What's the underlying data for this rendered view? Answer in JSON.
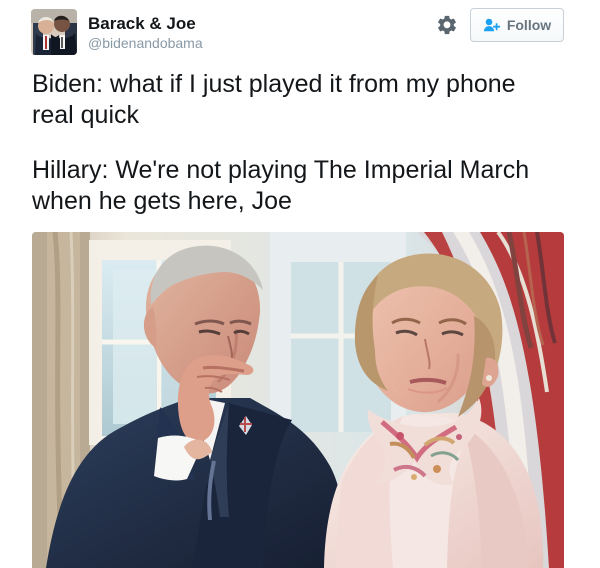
{
  "user": {
    "display_name": "Barack & Joe",
    "handle": "@bidenandobama",
    "avatar_icon": "profile-photo"
  },
  "actions": {
    "settings_icon": "gear-icon",
    "follow_icon": "follow-person-plus-icon",
    "follow_label": "Follow"
  },
  "tweet": {
    "line_1": "Biden: what if I just played it from my phone\nreal quick",
    "line_2": "Hillary: We're not playing The Imperial March\nwhen he gets here, Joe"
  },
  "media": {
    "type": "photo",
    "colors": {
      "flag_red": "#b83a3a",
      "window_blue": "#b8d2db",
      "suit_navy": "#162542",
      "jacket_pink": "#efd7d2",
      "hair_gray": "#c8c6c0",
      "hair_blonde": "#c5a67b"
    }
  }
}
